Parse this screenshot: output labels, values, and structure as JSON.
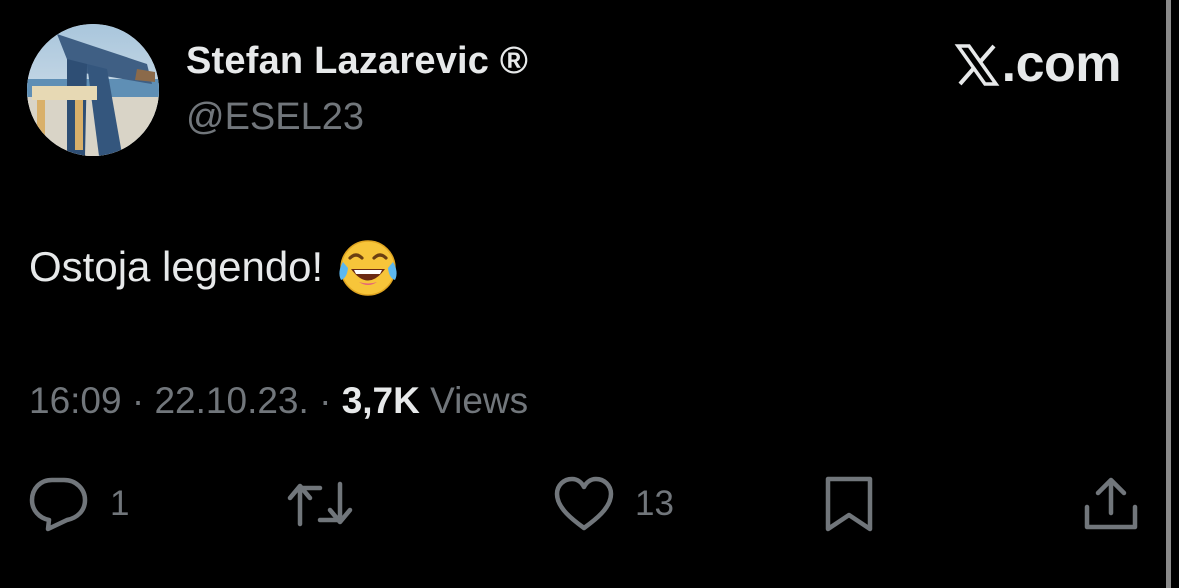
{
  "brand": {
    "label": ".com",
    "icon": "x-logo-icon"
  },
  "author": {
    "display_name": "Stefan Lazarevic ®",
    "handle": "@ESEL23",
    "avatar": "avatar-photo"
  },
  "tweet": {
    "text": "Ostoja legendo!",
    "emoji": "face-with-tears-of-joy-icon"
  },
  "meta": {
    "time": "16:09",
    "separator": "·",
    "date": "22.10.23.",
    "views_count": "3,7K",
    "views_label": "Views"
  },
  "actions": {
    "reply": {
      "icon": "reply-icon",
      "count": "1"
    },
    "retweet": {
      "icon": "retweet-icon",
      "count": ""
    },
    "like": {
      "icon": "heart-icon",
      "count": "13"
    },
    "bookmark": {
      "icon": "bookmark-icon"
    },
    "share": {
      "icon": "share-icon"
    }
  },
  "colors": {
    "background": "#000000",
    "primary_text": "#e7e9ea",
    "secondary_text": "#71767b"
  }
}
